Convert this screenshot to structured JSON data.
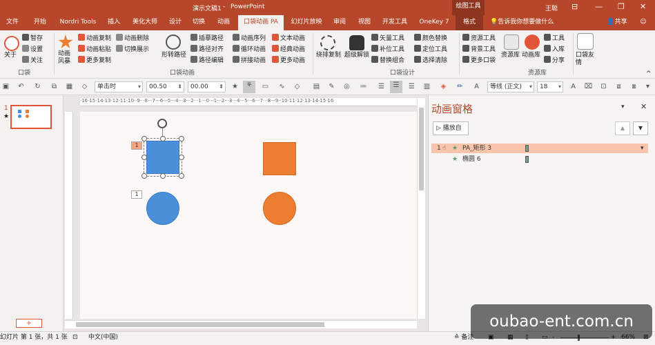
{
  "title_bar": {
    "document": "演示文稿1",
    "separator": "-",
    "app": "PowerPoint",
    "drawing_tools": "绘图工具",
    "user": "王聪"
  },
  "tabs": [
    "文件",
    "开始",
    "Nordri Tools",
    "插入",
    "美化大师",
    "设计",
    "切换",
    "动画",
    "口袋动画 PA",
    "幻灯片放映",
    "审阅",
    "视图",
    "开发工具",
    "OneKey 7",
    "格式"
  ],
  "active_tab": "口袋动画 PA",
  "tell_me": "告诉我你想要做什么",
  "share": "共享",
  "ribbon": {
    "group_pocket": {
      "label": "口袋",
      "about": "关于",
      "items": [
        "智存",
        "设置",
        "关注"
      ]
    },
    "group_anim": {
      "label": "口袋动画",
      "big1": "动画风暴",
      "col1": [
        "动画复制",
        "动画粘贴",
        "更多复制"
      ],
      "col2": [
        "动画删除",
        "切换展示"
      ],
      "big2": "形转路径",
      "col3": [
        "插摹路径",
        "路径对齐",
        "路径编辑"
      ],
      "col4": [
        "动画序列",
        "循环动画",
        "拼接动画"
      ],
      "col5": [
        "文本动画",
        "经典动画",
        "更多动画"
      ]
    },
    "group_design": {
      "label": "口袋设计",
      "big1": "绕排复制",
      "big2": "超级解锁",
      "col1": [
        "矢量工具",
        "补位工具",
        "替换组合"
      ],
      "col2": [
        "颜色替换",
        "定位工具",
        "选择清除"
      ]
    },
    "group_lib": {
      "label": "资源库",
      "col1": [
        "资源工具",
        "背景工具",
        "更多口袋"
      ],
      "big1": "资源库",
      "big2": "动画库",
      "col2": [
        "工具",
        "入库",
        "分享"
      ],
      "big3": "口袋友情"
    }
  },
  "toolbar": {
    "trigger": "单击时",
    "duration": "00.50",
    "delay": "00.00",
    "font": "等线 (正文)",
    "size": "18"
  },
  "slide_thumb_number": "1",
  "slide_thumb_star": "★",
  "slide": {
    "tag1": "1",
    "tag2": "1",
    "shapes": [
      {
        "name": "blue-square",
        "color": "#4a90d9"
      },
      {
        "name": "orange-square",
        "color": "#ed7d31"
      },
      {
        "name": "blue-circle",
        "color": "#4a90d9"
      },
      {
        "name": "orange-circle",
        "color": "#ed7d31"
      }
    ]
  },
  "anim_pane": {
    "title": "动画窗格",
    "play": "播放自",
    "items": [
      {
        "index": "1",
        "name": "PA_矩形 3"
      },
      {
        "index": "",
        "name": "椭圆 6"
      }
    ]
  },
  "status": {
    "slide_info": "幻灯片 第 1 张，共 1 张",
    "language": "中文(中国)",
    "notes": "备注",
    "zoom": "66%",
    "zoom_minus": "-",
    "zoom_plus": "+"
  },
  "watermark": "oubao-ent.com.cn",
  "add_slide": "+",
  "colors": {
    "accent": "#b7472a",
    "blue": "#4a90d9",
    "orange": "#ed7d31",
    "highlight": "#f8c4ab"
  }
}
